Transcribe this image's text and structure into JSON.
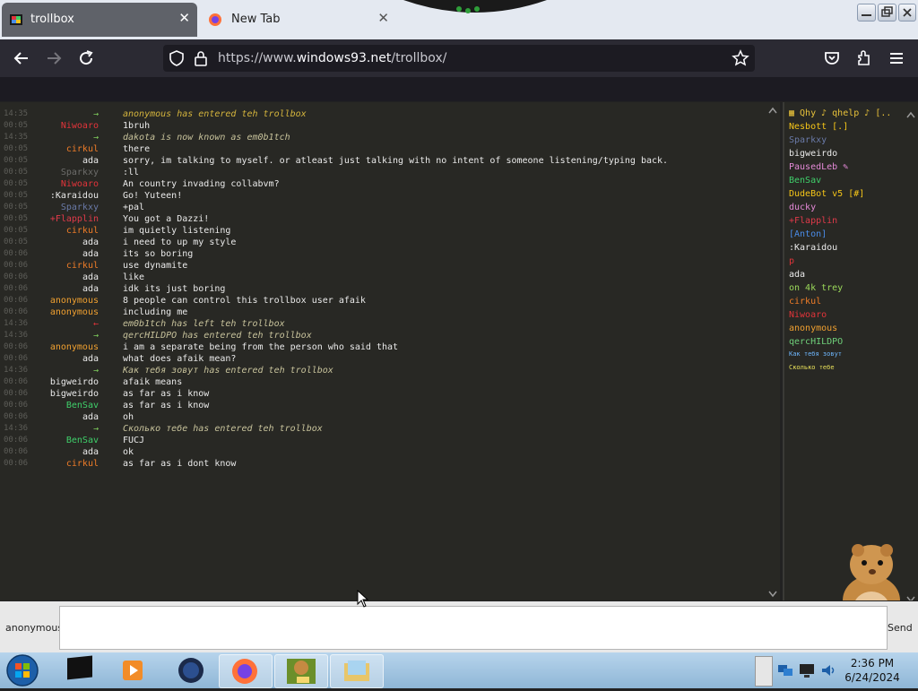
{
  "browser": {
    "tabs": [
      {
        "title": "trollbox",
        "active": true
      },
      {
        "title": "New Tab",
        "active": false
      }
    ],
    "url_host_prefix": "https://www.",
    "url_domain": "windows93.net",
    "url_path": "/trollbox/"
  },
  "chat": {
    "messages": [
      {
        "time": "14:35",
        "arrow": "→",
        "nick": "",
        "text": "anonymous has entered teh trollbox",
        "nick_color": "#7fce5d",
        "text_color": "#d4b43d",
        "system": true
      },
      {
        "time": "00:05",
        "nick": "Niwoaro",
        "text": "1bruh",
        "nick_color": "#e2343a",
        "text_color": "#eaeaea",
        "system": false
      },
      {
        "time": "14:35",
        "arrow": "→",
        "nick": "",
        "text": "dakota is now known as em0b1tch",
        "nick_color": "#7fce5d",
        "text_color": "#c7c29b",
        "system": true
      },
      {
        "time": "00:05",
        "nick": "cirkul",
        "text": "there",
        "nick_color": "#f07d28",
        "text_color": "#eaeaea",
        "system": false
      },
      {
        "time": "00:05",
        "nick": "ada",
        "text": "sorry, im talking to myself. or atleast just talking with no intent of someone listening/typing back.",
        "nick_color": "#eaeaea",
        "text_color": "#eaeaea",
        "system": false
      },
      {
        "time": "00:05",
        "nick": "Sparkxy",
        "text": ":ll",
        "nick_color": "#6d6d6b",
        "text_color": "#eaeaea",
        "system": false
      },
      {
        "time": "00:05",
        "nick": "Niwoaro",
        "text": "An country invading collabvm?",
        "nick_color": "#e2343a",
        "text_color": "#eaeaea",
        "system": false
      },
      {
        "time": "00:05",
        "nick": ":Karaidou",
        "text": "Go! Yuteen!",
        "nick_color": "#eaeaea",
        "text_color": "#eaeaea",
        "system": false
      },
      {
        "time": "00:05",
        "nick": "Sparkxy",
        "text": "+pal",
        "nick_color": "#6a7aa8",
        "text_color": "#eaeaea",
        "system": false
      },
      {
        "time": "00:05",
        "nick": "+Flapplin",
        "text": "You got a Dazzi!",
        "nick_color": "#e03a4a",
        "text_color": "#eaeaea",
        "system": false
      },
      {
        "time": "00:05",
        "nick": "cirkul",
        "text": "im quietly listening",
        "nick_color": "#f07d28",
        "text_color": "#eaeaea",
        "system": false
      },
      {
        "time": "00:05",
        "nick": "ada",
        "text": "i need to up my style",
        "nick_color": "#eaeaea",
        "text_color": "#eaeaea",
        "system": false
      },
      {
        "time": "00:06",
        "nick": "ada",
        "text": "its so boring",
        "nick_color": "#eaeaea",
        "text_color": "#eaeaea",
        "system": false
      },
      {
        "time": "00:06",
        "nick": "cirkul",
        "text": "use dynamite",
        "nick_color": "#f07d28",
        "text_color": "#eaeaea",
        "system": false
      },
      {
        "time": "00:06",
        "nick": "ada",
        "text": "like",
        "nick_color": "#eaeaea",
        "text_color": "#eaeaea",
        "system": false
      },
      {
        "time": "00:06",
        "nick": "ada",
        "text": "idk its just boring",
        "nick_color": "#eaeaea",
        "text_color": "#eaeaea",
        "system": false
      },
      {
        "time": "00:06",
        "nick": "anonymous",
        "text": "8 people can control this trollbox user afaik",
        "nick_color": "#f0a030",
        "text_color": "#eaeaea",
        "system": false
      },
      {
        "time": "00:06",
        "nick": "anonymous",
        "text": "including me",
        "nick_color": "#f0a030",
        "text_color": "#eaeaea",
        "system": false
      },
      {
        "time": "14:36",
        "arrow": "←",
        "nick": "",
        "text": "em0b1tch has left teh trollbox",
        "nick_color": "#e2343a",
        "text_color": "#c7c29b",
        "system": true
      },
      {
        "time": "14:36",
        "arrow": "→",
        "nick": "",
        "text": "qercHILDPO has entered teh trollbox",
        "nick_color": "#7fce5d",
        "text_color": "#c7c29b",
        "system": true
      },
      {
        "time": "00:06",
        "nick": "anonymous",
        "text": "i am a separate being from the person who said that",
        "nick_color": "#f0a030",
        "text_color": "#eaeaea",
        "system": false
      },
      {
        "time": "00:06",
        "nick": "ada",
        "text": "what does afaik mean?",
        "nick_color": "#eaeaea",
        "text_color": "#eaeaea",
        "system": false
      },
      {
        "time": "14:36",
        "arrow": "→",
        "nick": "",
        "text": "Как тебя зовут has entered teh trollbox",
        "nick_color": "#7fce5d",
        "text_color": "#c7c29b",
        "system": true
      },
      {
        "time": "00:06",
        "nick": "bigweirdo",
        "text": "afaik means",
        "nick_color": "#eaeaea",
        "text_color": "#eaeaea",
        "system": false
      },
      {
        "time": "00:06",
        "nick": "bigweirdo",
        "text": "as far as i know",
        "nick_color": "#eaeaea",
        "text_color": "#eaeaea",
        "system": false
      },
      {
        "time": "00:06",
        "nick": "BenSav",
        "text": "as far as i know",
        "nick_color": "#3fcf6a",
        "text_color": "#eaeaea",
        "system": false
      },
      {
        "time": "00:06",
        "nick": "ada",
        "text": "oh",
        "nick_color": "#eaeaea",
        "text_color": "#eaeaea",
        "system": false
      },
      {
        "time": "14:36",
        "arrow": "→",
        "nick": "",
        "text": "Сколько тебе has entered teh trollbox",
        "nick_color": "#7fce5d",
        "text_color": "#c7c29b",
        "system": true
      },
      {
        "time": "00:06",
        "nick": "BenSav",
        "text": "FUCJ",
        "nick_color": "#3fcf6a",
        "text_color": "#eaeaea",
        "system": false
      },
      {
        "time": "00:06",
        "nick": "ada",
        "text": "ok",
        "nick_color": "#eaeaea",
        "text_color": "#eaeaea",
        "system": false
      },
      {
        "time": "00:06",
        "nick": "cirkul",
        "text": "as far as i dont know",
        "nick_color": "#f07d28",
        "text_color": "#eaeaea",
        "system": false
      }
    ]
  },
  "users": [
    {
      "name": "▦ Qhy ♪ qhelp ♪ [..",
      "color": "#e8c23a"
    },
    {
      "name": "Nesbott [.]",
      "color": "#f5c518"
    },
    {
      "name": "Sparkxy",
      "color": "#6a7aa8"
    },
    {
      "name": "bigweirdo",
      "color": "#eaeaea"
    },
    {
      "name": "PausedLeb ✎",
      "color": "#e58ad8"
    },
    {
      "name": "BenSav",
      "color": "#3fcf6a"
    },
    {
      "name": "DudeBot v5 [#]",
      "color": "#f5c518"
    },
    {
      "name": "ducky",
      "color": "#e58ad8"
    },
    {
      "name": "+Flapplin",
      "color": "#e03a4a"
    },
    {
      "name": "[Anton]",
      "color": "#4a8ce8"
    },
    {
      "name": ":Karaidou",
      "color": "#eaeaea"
    },
    {
      "name": "p",
      "color": "#e2343a"
    },
    {
      "name": "ada",
      "color": "#eaeaea"
    },
    {
      "name": "on 4k trey",
      "color": "#9bd95a"
    },
    {
      "name": "cirkul",
      "color": "#f07d28"
    },
    {
      "name": "Niwoaro",
      "color": "#e2343a"
    },
    {
      "name": "anonymous",
      "color": "#f0a030"
    },
    {
      "name": "qercHILDPO",
      "color": "#6fd07a"
    },
    {
      "name": "Как тебя зовут",
      "color": "#6fb8ff"
    },
    {
      "name": "Сколько тебе",
      "color": "#e8e05a"
    }
  ],
  "input": {
    "nick": "anonymous",
    "value": "",
    "send_label": "Send"
  },
  "clock": {
    "time": "2:36 PM",
    "date": "6/24/2024"
  }
}
